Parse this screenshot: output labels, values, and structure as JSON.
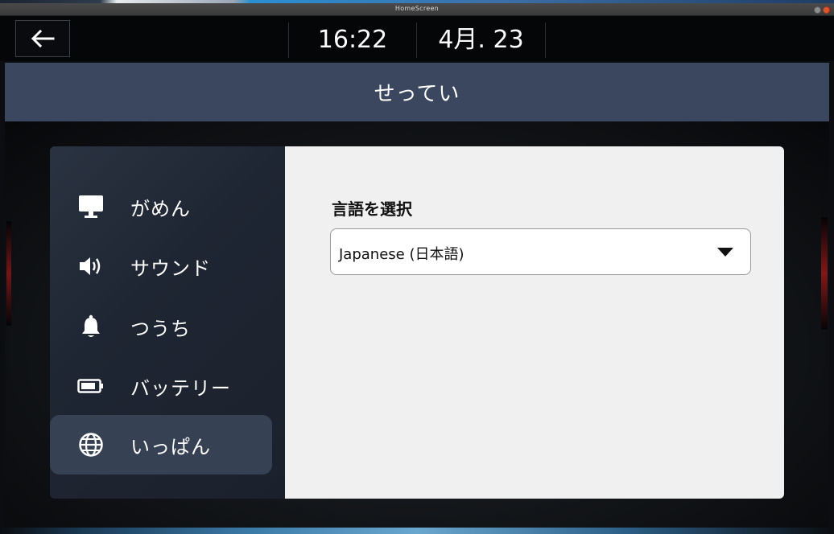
{
  "window": {
    "title": "HomeScreen"
  },
  "statusbar": {
    "back_icon": "arrow-left-icon",
    "time": "16:22",
    "date": "4月. 23"
  },
  "header": {
    "title": "せってい"
  },
  "sidebar": {
    "items": [
      {
        "id": "display",
        "label": "がめん",
        "icon": "monitor-icon",
        "active": false
      },
      {
        "id": "sound",
        "label": "サウンド",
        "icon": "speaker-icon",
        "active": false
      },
      {
        "id": "notifications",
        "label": "つうち",
        "icon": "bell-icon",
        "active": false
      },
      {
        "id": "battery",
        "label": "バッテリー",
        "icon": "battery-icon",
        "active": false
      },
      {
        "id": "general",
        "label": "いっぱん",
        "icon": "globe-icon",
        "active": true
      }
    ]
  },
  "content": {
    "section_label": "言語を選択",
    "language_select": {
      "value": "Japanese (日本語)",
      "icon": "caret-down-icon"
    }
  },
  "colors": {
    "header_bg": "#3b475e",
    "active_item_bg": "#364254",
    "panel_bg": "#f0f0f0"
  }
}
